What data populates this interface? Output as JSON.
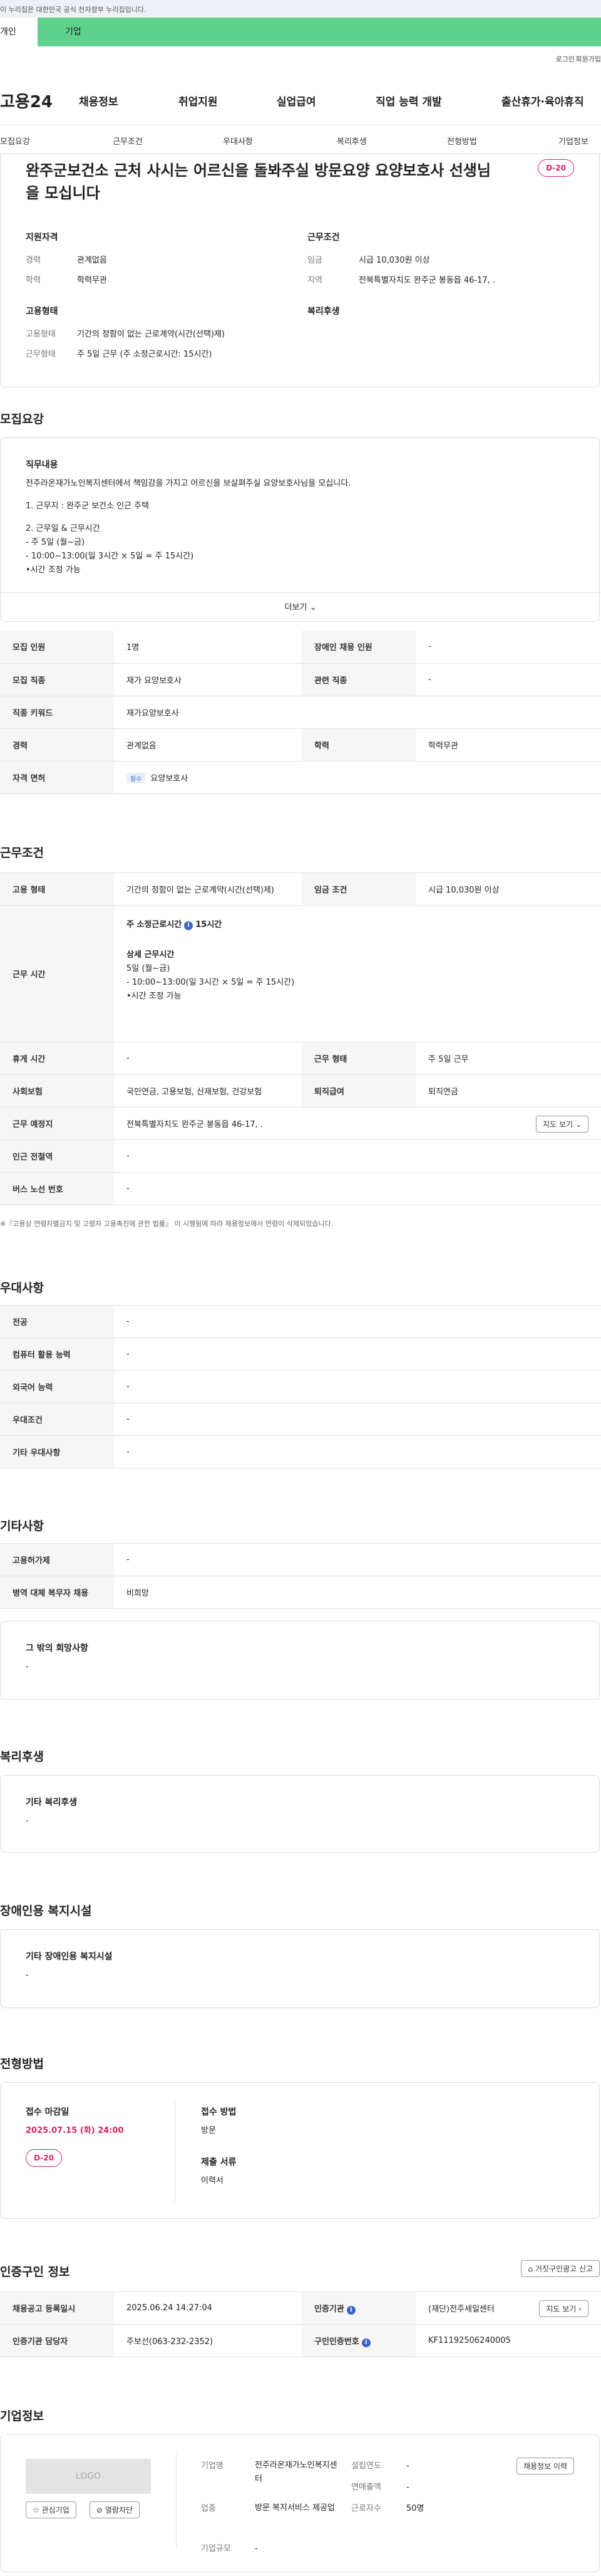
{
  "banner": "이 누리집은 대한민국 공식 전자정부 누리집입니다.",
  "tabs": {
    "person": "개인",
    "biz": "기업"
  },
  "util": {
    "login": "로그인",
    "join": "회원가입"
  },
  "logo": "고용24",
  "gnb": [
    "채용정보",
    "취업지원",
    "실업급여",
    "직업 능력 개발",
    "출산휴가·육아휴직"
  ],
  "subnav": [
    "모집요강",
    "근무조건",
    "우대사항",
    "복리후생",
    "전형방법",
    "기업정보"
  ],
  "job": {
    "title": "완주군보건소 근처 사시는 어르신을 돌봐주실 방문요양 요양보호사 선생님을 모십니다",
    "dday": "D-20",
    "qual_heading": "지원자격",
    "career_label": "경력",
    "career_value": "관계없음",
    "edu_label": "학력",
    "edu_value": "학력무관",
    "cond_heading": "근무조건",
    "wage_label": "임금",
    "wage_value": "시급 10,030원 이상",
    "region_label": "지역",
    "region_value": "전북특별자치도 완주군 봉동읍 46-17, .",
    "emp_heading": "고용형태",
    "emp_type_label": "고용형태",
    "emp_type_value": "기간의 정함이 없는 근로계약(시간(선택)제)",
    "work_type_label": "근무형태",
    "work_type_value": "주 5일 근무 (주 소정근로시간: 15시간)",
    "welfare_heading": "복리후생"
  },
  "recruit": {
    "section_title": "모집요강",
    "duty_heading": "직무내용",
    "duty_lines": [
      "전주라온재가노인복지센터에서 책임감을 가지고 어르신을 보살펴주실 요양보호사님을 모십니다.",
      "",
      "1. 근무지 :  완주군 보건소 인근 주택",
      "",
      "2. 근무일 & 근무시간",
      "- 주 5일 (월~금)",
      "- 10:00~13:00(일 3시간 × 5일 = 주 15시간)",
      "•시간 조정 가능"
    ],
    "more": "더보기",
    "headcount_label": "모집 인원",
    "headcount_value": "1명",
    "disabled_label": "장애인 채용 인원",
    "disabled_value": "-",
    "job_label": "모집 직종",
    "job_value": "재가 요양보호사",
    "related_label": "관련 직종",
    "related_value": "-",
    "keyword_label": "직종 키워드",
    "keyword_value": "재가요양보호사",
    "career_label": "경력",
    "career_value": "관계없음",
    "edu_label": "학력",
    "edu_value": "학력무관",
    "license_label": "자격 면허",
    "license_chip": "필수",
    "license_value": "요양보호사"
  },
  "conditions": {
    "section_title": "근무조건",
    "emp_label": "고용 형태",
    "emp_value": "기간의 정함이 없는 근로계약(시간(선택)제)",
    "wage_label": "임금 조건",
    "wage_value": "시급 10,030원 이상",
    "hours_label": "근무 시간",
    "hours_weekly_label": "주 소정근로시간",
    "hours_weekly_value": "15시간",
    "hours_detail_label": "상세 근무시간",
    "hours_lines": [
      "5일 (월~금)",
      "- 10:00~13:00(일 3시간 × 5일 = 주 15시간)",
      "•시간 조정 가능"
    ],
    "break_label": "휴게 시간",
    "break_value": "-",
    "worktype_label": "근무 형태",
    "worktype_value": "주 5일 근무",
    "insurance_label": "사회보험",
    "insurance_value": "국민연금, 고용보험, 산재보험, 건강보험",
    "retire_label": "퇴직급여",
    "retire_value": "퇴직연금",
    "place_label": "근무 예정지",
    "place_value": "전북특별자치도 완주군 봉동읍 46-17, .",
    "map_btn": "지도 보기",
    "subway_label": "인근 전철역",
    "subway_value": "-",
    "bus_label": "버스 노선 번호",
    "bus_value": "-",
    "note": "※『고용상 연령차별금지 및 고령자 고용촉진에 관한 법률』 이 시행됨에 따라 채용정보에서 연령이 삭제되었습니다."
  },
  "preference": {
    "section_title": "우대사항",
    "rows": [
      {
        "label": "전공",
        "value": "-"
      },
      {
        "label": "컴퓨터 활용 능력",
        "value": "-"
      },
      {
        "label": "외국어 능력",
        "value": "-"
      },
      {
        "label": "우대조건",
        "value": "-"
      },
      {
        "label": "기타 우대사항",
        "value": "-"
      }
    ]
  },
  "others": {
    "section_title": "기타사항",
    "employ_type_label": "고용허가제",
    "employ_type_value": "-",
    "military_label": "병역 대체 복무자 채용",
    "military_value": "비희망",
    "hope_heading": "그 밖의 희망사항",
    "hope_value": "-"
  },
  "welfare": {
    "section_title": "복리후생",
    "heading": "기타 복리후생",
    "value": "-"
  },
  "disabled_fac": {
    "section_title": "장애인용 복지시설",
    "heading": "기타 장애인용 복지시설",
    "value": "-"
  },
  "selection": {
    "section_title": "전형방법",
    "deadline_label": "접수 마감일",
    "deadline_value": "2025.07.15 (화) 24:00",
    "dday": "D-20",
    "method_label": "접수 방법",
    "method_value": "방문",
    "docs_label": "제출 서류",
    "docs_value": "이력서"
  },
  "cert": {
    "section_title": "인증구인 정보",
    "report_btn": "거짓구인광고 신고",
    "date_label": "채용공고 등록일시",
    "date_value": "2025.06.24 14:27:04",
    "org_label": "인증기관",
    "org_value": "(재단)전주세일센터",
    "map_btn": "지도 보기",
    "manager_label": "인증기관 담당자",
    "manager_value": "주보선(063-232-2352)",
    "num_label": "구인인증번호",
    "num_value": "KF11192506240005"
  },
  "company": {
    "section_title": "기업정보",
    "logo": "LOGO",
    "fav_btn": "관심기업",
    "block_btn": "열람차단",
    "name_label": "기업명",
    "name_value": "전주라온재가노인복지센터",
    "biz_label": "업종",
    "biz_value": "방문 복지서비스 제공업",
    "scale_label": "기업규모",
    "scale_value": "-",
    "founded_label": "설립연도",
    "founded_value": "-",
    "sales_label": "연매출액",
    "sales_value": "-",
    "staff_label": "근로자수",
    "staff_value": "50명",
    "jobs_btn": "채용정보 이력"
  },
  "colors": {
    "accent_green": "#5ed18d",
    "dday_red": "#d9245e",
    "info_blue": "#4062c9"
  }
}
